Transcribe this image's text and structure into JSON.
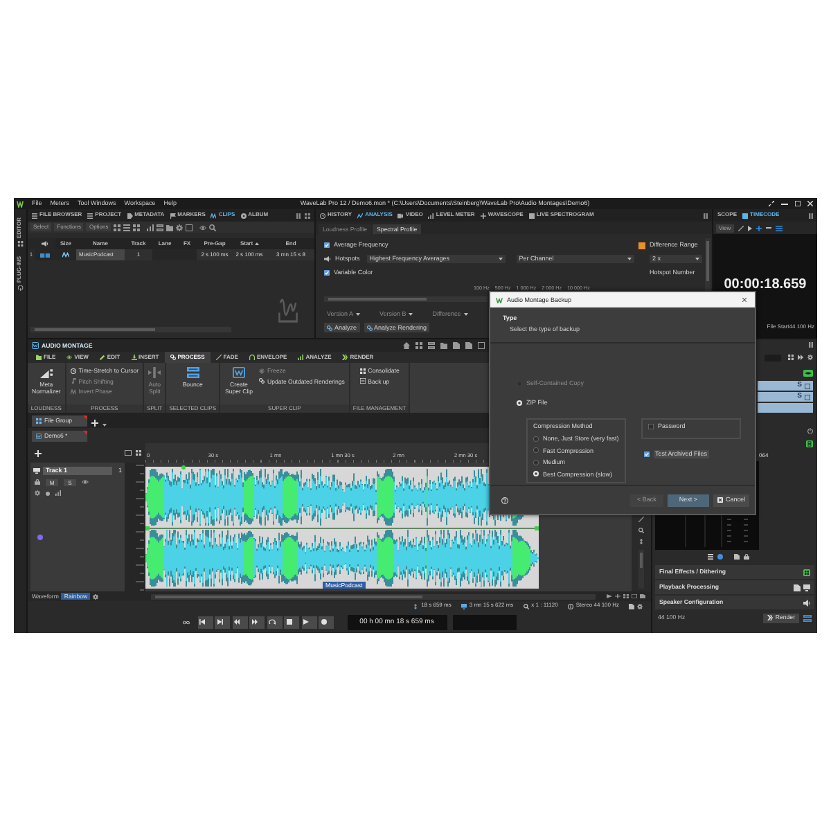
{
  "window": {
    "menu": [
      "File",
      "Meters",
      "Tool Windows",
      "Workspace",
      "Help"
    ],
    "title": "WaveLab Pro 12 / Demo6.mon * (C:\\Users\\Documents\\Steinberg\\WaveLab Pro\\Audio Montages\\Demo6)"
  },
  "side_tabs": [
    {
      "label": "EDITOR"
    },
    {
      "label": "PLUG-INS"
    }
  ],
  "clips_panel": {
    "tabs": [
      {
        "label": "FILE BROWSER",
        "selected": false
      },
      {
        "label": "PROJECT",
        "selected": false
      },
      {
        "label": "METADATA",
        "selected": false
      },
      {
        "label": "MARKERS",
        "selected": false
      },
      {
        "label": "CLIPS",
        "selected": true
      },
      {
        "label": "ALBUM",
        "selected": false
      }
    ],
    "toolbar": [
      "Select",
      "Functions",
      "Options"
    ],
    "columns": [
      {
        "label": "Size",
        "sorted": false
      },
      {
        "label": "Name",
        "sorted": false
      },
      {
        "label": "Track",
        "sorted": false
      },
      {
        "label": "Lane",
        "sorted": false
      },
      {
        "label": "FX",
        "sorted": false
      },
      {
        "label": "Pre-Gap",
        "sorted": false
      },
      {
        "label": "Start",
        "sorted": true
      },
      {
        "label": "End",
        "sorted": false
      }
    ],
    "rows": [
      {
        "number": "1",
        "name": "MusicPodcast",
        "track": "1",
        "pre_gap": "2 s 100 ms",
        "start": "2 s 100 ms",
        "end": "3 mn 15 s 8"
      }
    ]
  },
  "analysis_panel": {
    "tabs": [
      {
        "label": "HISTORY",
        "selected": false
      },
      {
        "label": "ANALYSIS",
        "selected": true
      },
      {
        "label": "VIDEO",
        "selected": false
      },
      {
        "label": "LEVEL METER",
        "selected": false
      },
      {
        "label": "WAVESCOPE",
        "selected": false
      },
      {
        "label": "LIVE SPECTROGRAM",
        "selected": false
      }
    ],
    "subtabs": [
      {
        "label": "Loudness Profile",
        "selected": false
      },
      {
        "label": "Spectral Profile",
        "selected": true
      }
    ],
    "options": [
      {
        "kind": "checkbox",
        "label": "Average Frequency",
        "checked": true
      },
      {
        "kind": "hotspots",
        "label": "Hotspots",
        "mode": "Highest Frequency Averages",
        "channels": "Per Channel"
      },
      {
        "kind": "checkbox",
        "label": "Variable Color",
        "checked": true
      }
    ],
    "difference_range": {
      "label": "Difference Range",
      "value": "2 x"
    },
    "hotspot_number": "Hotspot Number",
    "scale": [
      "100 Hz",
      "500 Hz",
      "1 000 Hz",
      "2 000 Hz",
      "10 000 Hz"
    ],
    "versions": [
      {
        "label": "Version A",
        "disabled": true
      },
      {
        "label": "Version B",
        "disabled": true
      },
      {
        "label": "Difference",
        "disabled": true
      }
    ],
    "buttons": [
      "Analyze",
      "Analyze Rendering"
    ]
  },
  "timecode_panel": {
    "tabs": [
      {
        "label": "SCOPE",
        "selected": false
      },
      {
        "label": "TIMECODE",
        "selected": true
      }
    ],
    "view": "View",
    "time": "00:00:18.659",
    "reference": "File Start",
    "sample_rate": "44 100 Hz"
  },
  "montage": {
    "title": "AUDIO MONTAGE",
    "ribbon_tabs": [
      {
        "label": "FILE",
        "selected": false
      },
      {
        "label": "VIEW",
        "selected": false
      },
      {
        "label": "EDIT",
        "selected": false
      },
      {
        "label": "INSERT",
        "selected": false
      },
      {
        "label": "PROCESS",
        "selected": true
      },
      {
        "label": "FADE",
        "selected": false
      },
      {
        "label": "ENVELOPE",
        "selected": false
      },
      {
        "label": "ANALYZE",
        "selected": false
      },
      {
        "label": "RENDER",
        "selected": false
      }
    ],
    "groups": [
      {
        "label": "LOUDNESS",
        "commands": [
          {
            "label": "Meta Normalizer",
            "kind": "large",
            "disabled": false
          }
        ]
      },
      {
        "label": "PROCESS",
        "commands": [
          {
            "label": "Time-Stretch to Cursor",
            "kind": "small",
            "disabled": false
          },
          {
            "label": "Pitch Shifting",
            "kind": "small",
            "disabled": true
          },
          {
            "label": "Invert Phase",
            "kind": "small",
            "disabled": true
          }
        ]
      },
      {
        "label": "SPLIT",
        "commands": [
          {
            "label": "Auto Split",
            "kind": "large",
            "disabled": true
          }
        ]
      },
      {
        "label": "SELECTED CLIPS",
        "commands": [
          {
            "label": "Bounce",
            "kind": "large",
            "disabled": false
          }
        ]
      },
      {
        "label": "SUPER CLIP",
        "commands": [
          {
            "label": "Create Super Clip",
            "kind": "large",
            "disabled": false
          },
          {
            "label": "Freeze",
            "kind": "small",
            "disabled": true
          },
          {
            "label": "Update Outdated Renderings",
            "kind": "small",
            "disabled": false
          }
        ]
      },
      {
        "label": "FILE MANAGEMENT",
        "commands": [
          {
            "label": "Consolidate",
            "kind": "small",
            "disabled": false
          },
          {
            "label": "Back up",
            "kind": "small",
            "disabled": false
          }
        ]
      }
    ],
    "file_groups": [
      {
        "label": "File Group",
        "selected": true
      }
    ],
    "documents": [
      {
        "label": "Demo6 *",
        "selected": true
      }
    ],
    "ruler": [
      "0",
      "30 s",
      "1 mn",
      "1 mn 30 s",
      "2 mn",
      "2 mn 30 s"
    ],
    "track": {
      "name": "Track 1",
      "number": "1",
      "buttons": [
        "M",
        "S"
      ]
    },
    "clip": {
      "name": "MusicPodcast"
    },
    "waveform_style": {
      "label": "Waveform",
      "value": "Rainbow"
    },
    "status": [
      "18 s 659 ms",
      "3 mn 15 s 622 ms",
      "x 1 : 11120",
      "Stereo 44 100 Hz"
    ],
    "transport_time": "00 h 00 mn 18 s 659 ms"
  },
  "master_section": {
    "solo_buttons": [
      "S",
      "S"
    ],
    "meter_reading": "064",
    "sections": [
      "Final Effects / Dithering",
      "Playback Processing",
      "Speaker Configuration"
    ],
    "sample_rate": "44 100 Hz",
    "render": "Render"
  },
  "dialog": {
    "title": "Audio Montage Backup",
    "heading": "Type",
    "description": "Select the type of backup",
    "types": [
      {
        "label": "Self-Contained Copy",
        "selected": false,
        "disabled": true
      },
      {
        "label": "ZIP File",
        "selected": true,
        "disabled": false
      }
    ],
    "compression": {
      "label": "Compression Method",
      "options": [
        {
          "label": "None, Just Store (very fast)",
          "selected": false
        },
        {
          "label": "Fast Compression",
          "selected": false
        },
        {
          "label": "Medium",
          "selected": false
        },
        {
          "label": "Best Compression (slow)",
          "selected": true
        }
      ]
    },
    "password": {
      "label": "Password",
      "checked": false
    },
    "test_archived": {
      "label": "Test Archived Files",
      "checked": true
    },
    "buttons": [
      {
        "label": "< Back",
        "kind": "text",
        "disabled": true,
        "default": false
      },
      {
        "label": "Next >",
        "kind": "text",
        "disabled": false,
        "default": true
      },
      {
        "label": "Cancel",
        "kind": "icon",
        "disabled": false,
        "default": false
      }
    ]
  }
}
